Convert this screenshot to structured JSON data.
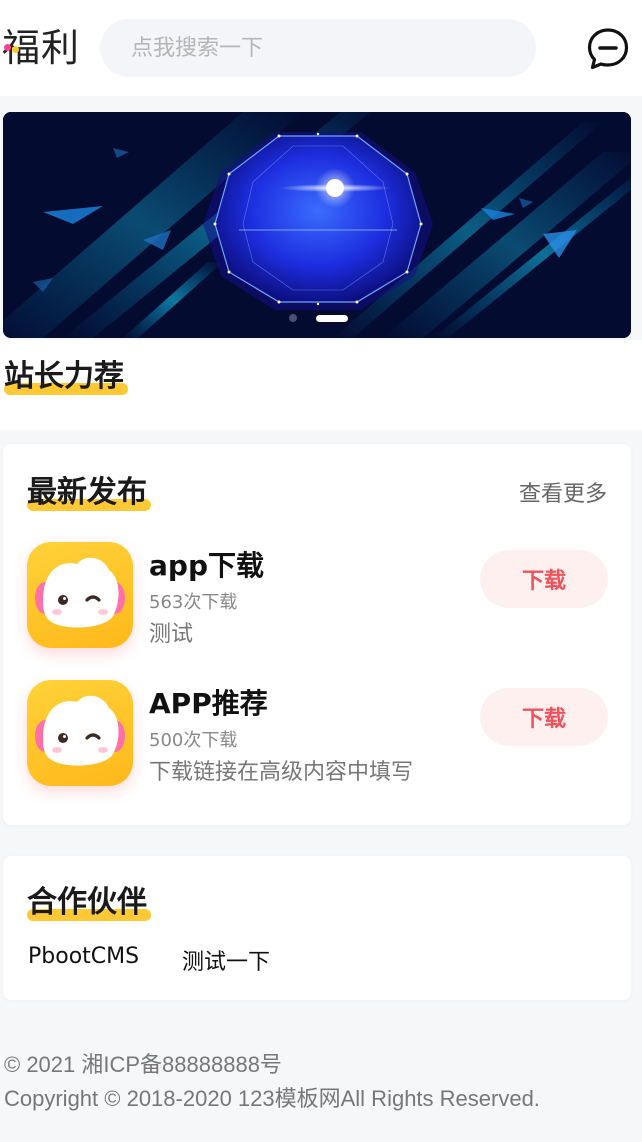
{
  "header": {
    "logo_text": "福利",
    "search_placeholder": "点我搜索一下",
    "message_icon": "chat-bubble-icon"
  },
  "banner": {
    "slide_count": 2,
    "active_slide": 2
  },
  "recommend": {
    "title": "站长力荐"
  },
  "latest": {
    "title": "最新发布",
    "more_label": "查看更多",
    "apps": [
      {
        "name": "app下载",
        "count": "563次下载",
        "desc": "测试",
        "button": "下载"
      },
      {
        "name": "APP推荐",
        "count": "500次下载",
        "desc": "下载链接在高级内容中填写",
        "button": "下载"
      }
    ]
  },
  "partners": {
    "title": "合作伙伴",
    "links": [
      "PbootCMS",
      "测试一下"
    ]
  },
  "footer": {
    "icp": "© 2021 湘ICP备88888888号",
    "copyright": "Copyright © 2018-2020 123模板网All Rights Reserved."
  },
  "colors": {
    "accent_yellow": "#ffc935",
    "download_text": "#f0525b",
    "download_bg": "#fff0f0"
  }
}
